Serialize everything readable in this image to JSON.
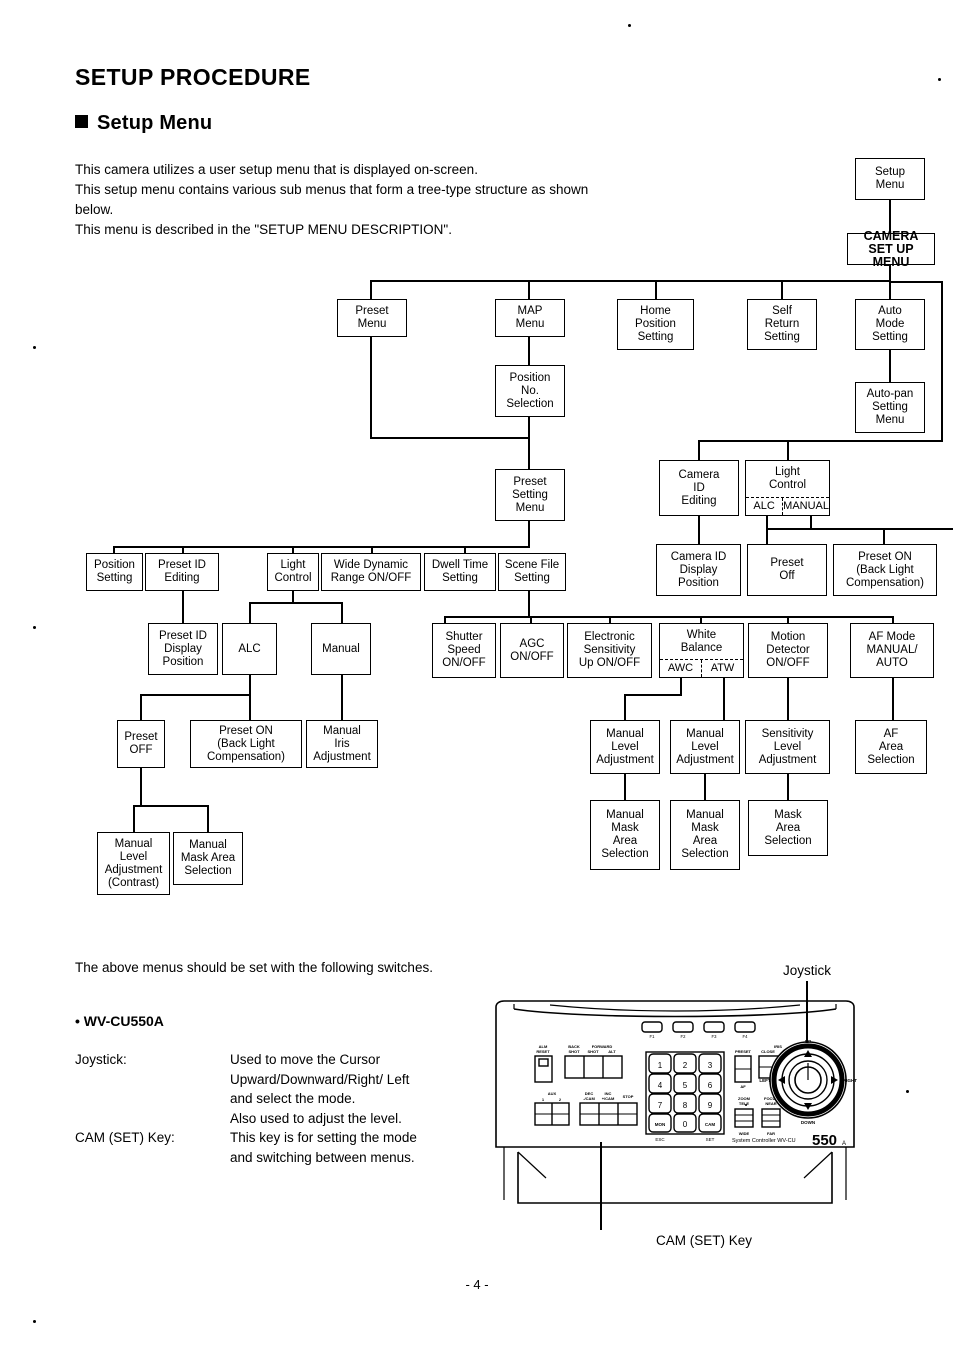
{
  "page": {
    "title": "SETUP PROCEDURE",
    "section_heading": "Setup Menu",
    "intro": "This camera utilizes a user setup menu that is displayed on-screen.\nThis setup menu contains various sub menus that form a tree-type structure as shown\nbelow.\nThis menu is described in the \"SETUP MENU DESCRIPTION\".",
    "lower_note": "The above menus should be set with the following switches.",
    "model_label": "• WV-CU550A",
    "page_number": "- 4 -"
  },
  "diagram": {
    "nodes": {
      "setup_menu": "Setup\nMenu",
      "camera_setup_menu": "CAMERA\nSET UP MENU",
      "preset_menu": "Preset\nMenu",
      "map_menu": "MAP\nMenu",
      "home_position_setting": "Home\nPosition\nSetting",
      "self_return_setting": "Self\nReturn\nSetting",
      "auto_mode_setting": "Auto\nMode\nSetting",
      "auto_pan_setting_menu": "Auto-pan\nSetting\nMenu",
      "position_no_selection": "Position\nNo.\nSelection",
      "preset_setting_menu": "Preset\nSetting\nMenu",
      "camera_id_editing": "Camera\nID\nEditing",
      "light_control_right": "Light\nControl",
      "light_control_right_opt1": "ALC",
      "light_control_right_opt2": "MANUAL",
      "position_setting": "Position\nSetting",
      "preset_id_editing": "Preset ID\nEditing",
      "light_control_left": "Light\nControl",
      "wide_dynamic_range": "Wide Dynamic\nRange ON/OFF",
      "dwell_time_setting": "Dwell Time\nSetting",
      "scene_file_setting": "Scene File\nSetting",
      "camera_id_display_position": "Camera ID\nDisplay\nPosition",
      "preset_off_right": "Preset\nOff",
      "preset_on_right": "Preset ON\n(Back Light\nCompensation)",
      "preset_id_display_position": "Preset ID\nDisplay\nPosition",
      "alc": "ALC",
      "manual": "Manual",
      "shutter_speed": "Shutter\nSpeed\nON/OFF",
      "agc": "AGC\nON/OFF",
      "electronic_sensitivity": "Electronic\nSensitivity\nUp ON/OFF",
      "white_balance": "White\nBalance",
      "white_balance_opt1": "AWC",
      "white_balance_opt2": "ATW",
      "motion_detector": "Motion\nDetector\nON/OFF",
      "af_mode": "AF Mode\nMANUAL/\nAUTO",
      "preset_off_left": "Preset\nOFF",
      "preset_on_left": "Preset ON\n(Back Light\nCompensation)",
      "manual_iris_adjustment": "Manual\nIris\nAdjustment",
      "manual_level_adjustment_awc": "Manual\nLevel\nAdjustment",
      "manual_level_adjustment_atw": "Manual\nLevel\nAdjustment",
      "sensitivity_level_adjustment": "Sensitivity\nLevel\nAdjustment",
      "af_area_selection": "AF\nArea\nSelection",
      "manual_level_adjustment_contrast": "Manual\nLevel\nAdjustment\n(Contrast)",
      "manual_mask_area_selection_left": "Manual\nMask Area\nSelection",
      "manual_mask_area_selection_awc": "Manual\nMask\nArea\nSelection",
      "manual_mask_area_selection_atw": "Manual\nMask\nArea\nSelection",
      "mask_area_selection": "Mask\nArea\nSelection"
    }
  },
  "switches": {
    "rows": [
      {
        "term": "Joystick:",
        "desc": "Used to move the Cursor\nUpward/Downward/Right/ Left\nand select the mode.\nAlso used to adjust the level."
      },
      {
        "term": "CAM (SET) Key:",
        "desc": "This key is for setting the mode\nand switching between menus."
      }
    ]
  },
  "controller": {
    "callout_joystick": "Joystick",
    "callout_cam_set_key": "CAM (SET) Key",
    "brand_text": "System Controller WV-CU",
    "model_number": "550",
    "model_suffix": "A",
    "function_keys": [
      "F1",
      "F2",
      "F3",
      "F4"
    ],
    "keypad": [
      "1",
      "2",
      "3",
      "4",
      "5",
      "6",
      "7",
      "8",
      "9",
      "MON",
      "0",
      "CAM"
    ],
    "keypad_lower_left": "ESC",
    "keypad_lower_right": "SET",
    "left_group_labels": {
      "alm_reset": "ALM\nRESET",
      "back_forward": "BACK FORWARD",
      "back_sub": "SHOT",
      "forward_sub": "SHOT",
      "alt": "ALT",
      "aux": "AUX",
      "aux_1": "1",
      "aux_2": "2",
      "dec": "DEC\n-/CAM",
      "inc": "INC\n+/CAM",
      "stop": "STOP"
    },
    "right_group_labels": {
      "preset": "PRESET",
      "preset_sub": "AF",
      "iris": "IRIS",
      "close": "CLOSE",
      "open": "OPEN",
      "zoom": "ZOOM\nTELE",
      "zoom_sub": "WIDE",
      "focus": "FOCUS\nNEAR",
      "focus_sub": "FAR"
    },
    "joystick_labels": {
      "up": "UP",
      "down": "DOWN",
      "left": "LEFT",
      "right": "RIGHT"
    }
  },
  "colors": {
    "ink": "#000000",
    "paper": "#ffffff"
  }
}
